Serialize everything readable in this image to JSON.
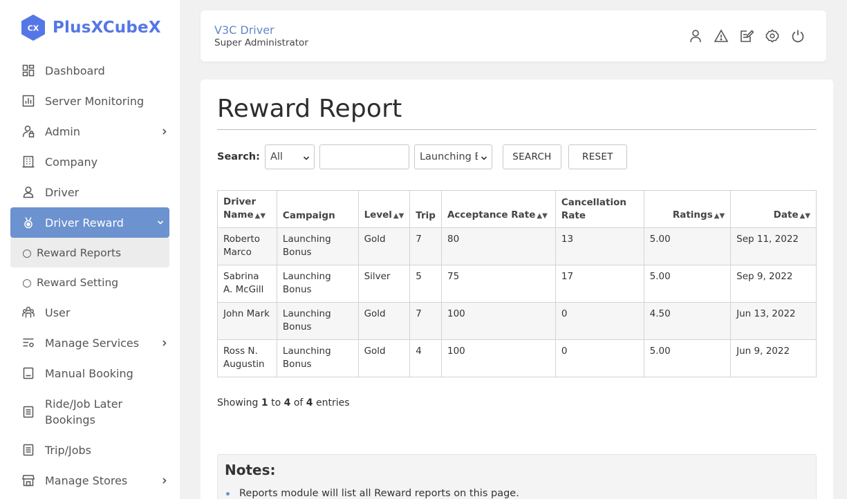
{
  "brand": {
    "logo_text": "CX",
    "name": "PlusXCubeX",
    "color": "#5577e6"
  },
  "sidebar": {
    "items": [
      {
        "label": "Dashboard",
        "icon": "dashboard-icon"
      },
      {
        "label": "Server Monitoring",
        "icon": "chart-icon"
      },
      {
        "label": "Admin",
        "icon": "admin-lock-icon",
        "chevron": true
      },
      {
        "label": "Company",
        "icon": "building-icon"
      },
      {
        "label": "Driver",
        "icon": "person-icon"
      },
      {
        "label": "Driver Reward",
        "icon": "medal-icon",
        "active": true,
        "expanded": true
      },
      {
        "label": "User",
        "icon": "users-icon"
      },
      {
        "label": "Manage Services",
        "icon": "services-icon",
        "chevron": true
      },
      {
        "label": "Manual Booking",
        "icon": "book-icon"
      },
      {
        "label": "Ride/Job Later Bookings",
        "icon": "list-icon"
      },
      {
        "label": "Trip/Jobs",
        "icon": "list-icon"
      },
      {
        "label": "Manage Stores",
        "icon": "store-icon",
        "chevron": true
      }
    ],
    "sub_items": [
      {
        "label": "Reward Reports",
        "current": true
      },
      {
        "label": "Reward Setting"
      }
    ],
    "active_color": "#6c92cf"
  },
  "header": {
    "user_name": "V3C Driver",
    "user_role": "Super Administrator",
    "icons": [
      "user-icon",
      "alert-icon",
      "edit-icon",
      "settings-icon",
      "power-icon"
    ]
  },
  "main": {
    "title": "Reward Report",
    "search": {
      "label": "Search:",
      "filter_value": "All",
      "text_value": "",
      "campaign_value": "Launching Bonus",
      "search_label": "SEARCH",
      "reset_label": "RESET"
    },
    "table": {
      "headers": [
        {
          "label": "Driver Name",
          "sortable": true
        },
        {
          "label": "Campaign",
          "sortable": false
        },
        {
          "label": "Level",
          "sortable": true
        },
        {
          "label": "Trip",
          "sortable": false
        },
        {
          "label": "Acceptance Rate",
          "sortable": true
        },
        {
          "label": "Cancellation Rate",
          "sortable": false
        },
        {
          "label": "Ratings",
          "sortable": true
        },
        {
          "label": "Date",
          "sortable": true
        }
      ],
      "rows": [
        [
          "Roberto Marco",
          "Launching Bonus",
          "Gold",
          "7",
          "80",
          "13",
          "5.00",
          "Sep 11, 2022"
        ],
        [
          "Sabrina A. McGill",
          "Launching Bonus",
          "Silver",
          "5",
          "75",
          "17",
          "5.00",
          "Sep 9, 2022"
        ],
        [
          "John Mark",
          "Launching Bonus",
          "Gold",
          "7",
          "100",
          "0",
          "4.50",
          "Jun 13, 2022"
        ],
        [
          "Ross N. Augustin",
          "Launching Bonus",
          "Gold",
          "4",
          "100",
          "0",
          "5.00",
          "Jun 9, 2022"
        ]
      ]
    },
    "showing": {
      "prefix": "Showing",
      "from": "1",
      "to_word": "to",
      "to": "4",
      "of_word": "of",
      "total": "4",
      "suffix": "entries"
    },
    "notes": {
      "title": "Notes:",
      "items": [
        "Reports module will list all Reward reports on this page."
      ]
    }
  }
}
